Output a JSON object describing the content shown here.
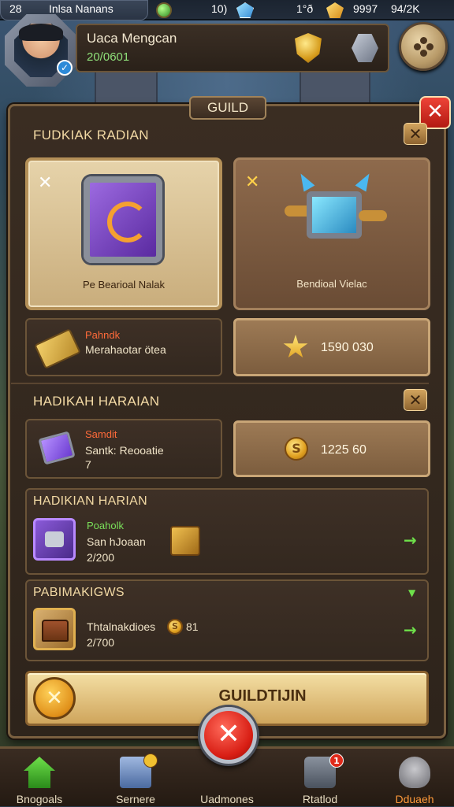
{
  "topbar": {
    "left_number": "28",
    "player_short": "Inlsa Nanans",
    "gem_count": "10)",
    "gold_icon_count": "1°ð",
    "gold_count": "9997",
    "energy": "94/2K"
  },
  "profile": {
    "name": "Uaca Mengcan",
    "level": "20/0601",
    "badge": "✓"
  },
  "panel": {
    "tab_label": "GUILD",
    "close_label": "✕"
  },
  "section1": {
    "title": "FUDKIAK RADIAN",
    "close_label": "✕",
    "card_left": {
      "x_label": "✕",
      "caption": "Pe Bearioal Nalak"
    },
    "card_right": {
      "x_label": "✕",
      "caption": "Bendioal Vielac"
    },
    "row_left": {
      "name": "Pahndk",
      "desc": "Merahaotar ötea"
    },
    "row_right": {
      "value": "1590 030"
    }
  },
  "section2": {
    "title": "HADIKAH HARAIAN",
    "close_label": "✕",
    "row_left": {
      "name": "Samdit",
      "desc": "Santk: Reooatie",
      "count": "7"
    },
    "row_right": {
      "value": "1225 60",
      "coin_symbol": "S"
    }
  },
  "section3": {
    "title": "HADIKIAN HARIAN",
    "row": {
      "name": "Poaholk",
      "desc": "San hJoaan",
      "count": "2/200",
      "arrow": "→"
    }
  },
  "section4": {
    "title": "PABIMAKIGWS",
    "row": {
      "desc": "Thtalnakdioes",
      "coin_symbol": "S",
      "coin_count": "81",
      "count": "2/700",
      "arrow": "→"
    }
  },
  "guild_bar": {
    "label": "GUILDTIJIN",
    "circle_label": "✕"
  },
  "center_button": {
    "label": "✕"
  },
  "bottom_nav": {
    "items": [
      {
        "label": "Bnogoals"
      },
      {
        "label": "Sernere"
      },
      {
        "label": "Uadmones"
      },
      {
        "label": "Rtatlod",
        "badge": "1"
      },
      {
        "label": "Dduaeh"
      }
    ]
  },
  "colors": {
    "accent_orange": "#ff9a3a",
    "item_name_red": "#ff6a3a",
    "item_name_green": "#7ae05a",
    "close_red": "#d81e14"
  }
}
